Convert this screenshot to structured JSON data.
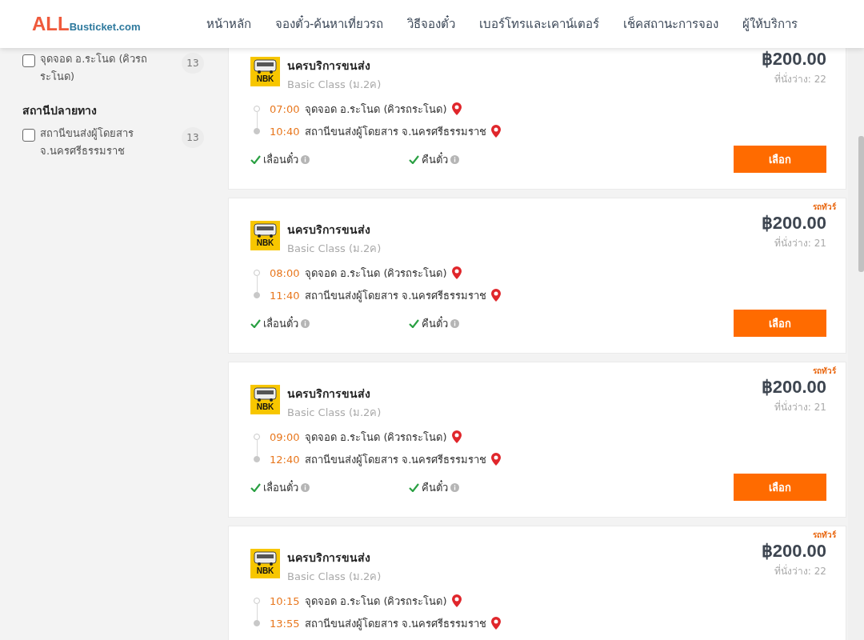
{
  "header": {
    "logo": {
      "part_1": "ALL",
      "part_2": "Busticket.com"
    },
    "nav": [
      "หน้าหลัก",
      "จองตั๋ว-ค้นหาเที่ยวรถ",
      "วิธีจองตั๋ว",
      "เบอร์โทรและเคาน์เตอร์",
      "เช็คสถานะการจอง",
      "ผู้ให้บริการ"
    ]
  },
  "sidebar": {
    "groups": [
      {
        "items": [
          {
            "label": "จุดจอด อ.ระโนด (คิวรถระโนด)",
            "count": "13",
            "checked": false
          }
        ]
      },
      {
        "heading": "สถานีปลายทาง",
        "items": [
          {
            "label": "สถานีขนส่งผู้โดยสาร จ.นครศรีธรรมราช",
            "count": "13",
            "checked": false
          }
        ]
      }
    ]
  },
  "trips": [
    {
      "operator_logo": "NBK",
      "operator": "นครบริการขนส่ง",
      "class": "Basic Class (ม.2ค)",
      "price": "฿200.00",
      "seats": "ที่นั่งว่าง: 22",
      "stops": [
        {
          "time": "07:00",
          "place": "จุดจอด อ.ระโนด (คิวรถระโนด)"
        },
        {
          "time": "10:40",
          "place": "สถานีขนส่งผู้โดยสาร จ.นครศรีธรรมราช"
        }
      ],
      "features": [
        {
          "label": "เลื่อนตั๋ว",
          "available": true
        },
        {
          "label": "คืนตั๋ว",
          "available": true
        }
      ],
      "button": "เลือก"
    },
    {
      "badge": "รถทัวร์",
      "operator_logo": "NBK",
      "operator": "นครบริการขนส่ง",
      "class": "Basic Class (ม.2ค)",
      "price": "฿200.00",
      "seats": "ที่นั่งว่าง: 21",
      "stops": [
        {
          "time": "08:00",
          "place": "จุดจอด อ.ระโนด (คิวรถระโนด)"
        },
        {
          "time": "11:40",
          "place": "สถานีขนส่งผู้โดยสาร จ.นครศรีธรรมราช"
        }
      ],
      "features": [
        {
          "label": "เลื่อนตั๋ว",
          "available": true
        },
        {
          "label": "คืนตั๋ว",
          "available": true
        }
      ],
      "button": "เลือก"
    },
    {
      "badge": "รถทัวร์",
      "operator_logo": "NBK",
      "operator": "นครบริการขนส่ง",
      "class": "Basic Class (ม.2ค)",
      "price": "฿200.00",
      "seats": "ที่นั่งว่าง: 21",
      "stops": [
        {
          "time": "09:00",
          "place": "จุดจอด อ.ระโนด (คิวรถระโนด)"
        },
        {
          "time": "12:40",
          "place": "สถานีขนส่งผู้โดยสาร จ.นครศรีธรรมราช"
        }
      ],
      "features": [
        {
          "label": "เลื่อนตั๋ว",
          "available": true
        },
        {
          "label": "คืนตั๋ว",
          "available": true
        }
      ],
      "button": "เลือก"
    },
    {
      "badge": "รถทัวร์",
      "operator_logo": "NBK",
      "operator": "นครบริการขนส่ง",
      "class": "Basic Class (ม.2ค)",
      "price": "฿200.00",
      "seats": "ที่นั่งว่าง: 22",
      "stops": [
        {
          "time": "10:15",
          "place": "จุดจอด อ.ระโนด (คิวรถระโนด)"
        },
        {
          "time": "13:55",
          "place": "สถานีขนส่งผู้โดยสาร จ.นครศรีธรรมราช"
        }
      ]
    }
  ]
}
